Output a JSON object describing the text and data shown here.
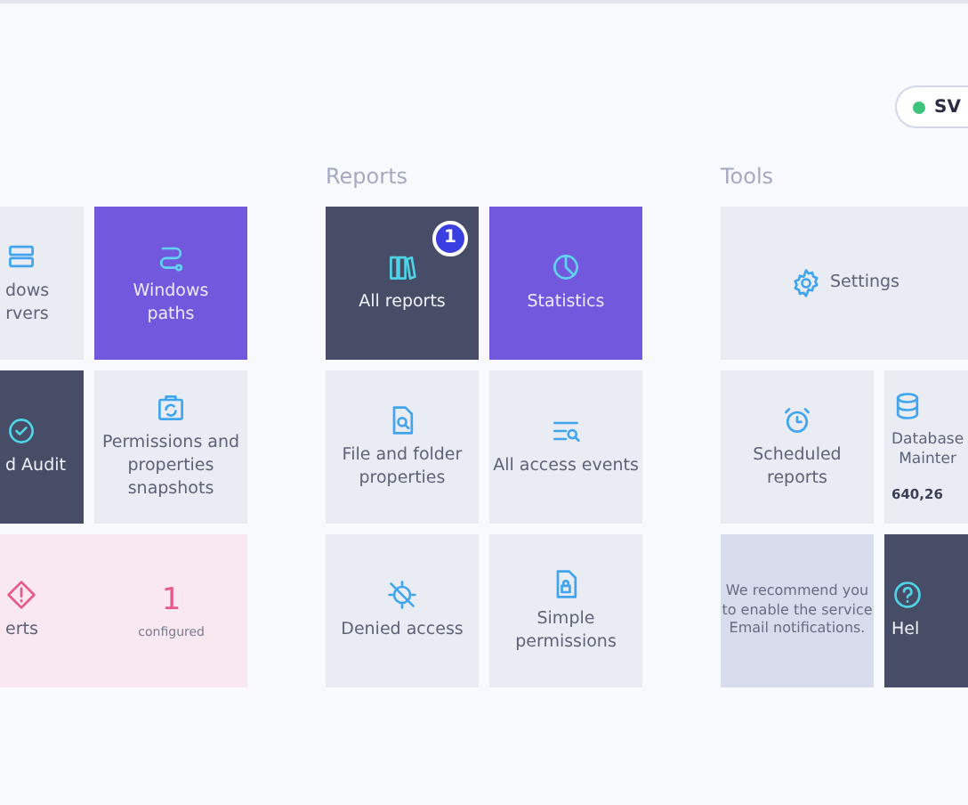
{
  "status": {
    "label": "SV",
    "online": true
  },
  "groups": [
    {
      "tiles": [
        {
          "kind": "light",
          "label": "dows\nrvers"
        },
        {
          "kind": "purple",
          "label": "Windows\npaths"
        },
        {
          "kind": "dark",
          "label": "d Audit"
        },
        {
          "kind": "light",
          "label": "Permissions and\nproperties\nsnapshots"
        },
        {
          "kind": "alert",
          "wide": true,
          "label": "erts",
          "count": "1",
          "count_label": "configured"
        }
      ]
    },
    {
      "title": "Reports",
      "tiles": [
        {
          "kind": "dark",
          "label": "All reports",
          "badge": "1"
        },
        {
          "kind": "purple",
          "label": "Statistics"
        },
        {
          "kind": "light",
          "label": "File and folder\nproperties"
        },
        {
          "kind": "light",
          "label": "All access events"
        },
        {
          "kind": "light",
          "label": "Denied access"
        },
        {
          "kind": "light",
          "label": "Simple\npermissions"
        }
      ]
    },
    {
      "title": "Tools",
      "tiles": [
        {
          "kind": "light",
          "wide": true,
          "label": "Settings"
        },
        {
          "kind": "light",
          "label": "Scheduled\nreports"
        },
        {
          "kind": "light",
          "label": "Database\nMainter",
          "value": "640,26"
        },
        {
          "kind": "notice",
          "label": "We recommend you\nto enable the service\nEmail notifications."
        },
        {
          "kind": "dark",
          "label": "Hel"
        }
      ]
    }
  ]
}
